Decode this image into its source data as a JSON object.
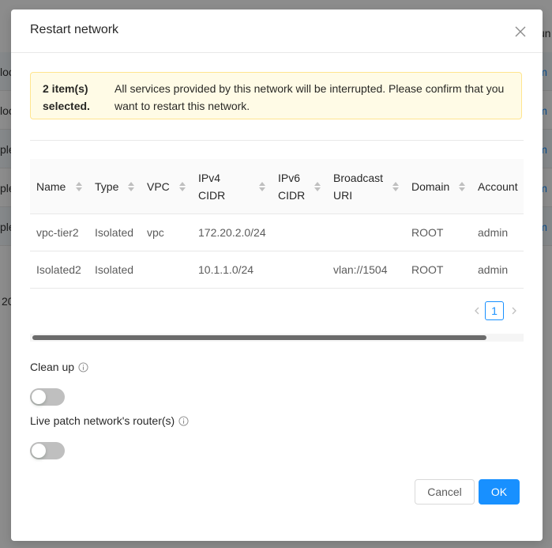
{
  "background": {
    "rows": [
      {
        "text": "loc",
        "link": "m"
      },
      {
        "text": "loc",
        "link": "m"
      },
      {
        "text": "ple",
        "link": "m"
      },
      {
        "text": "ple",
        "link": "m"
      },
      {
        "text": "ple",
        "link": "m"
      }
    ],
    "footer_text": "20",
    "header_text": "un"
  },
  "modal": {
    "title": "Restart network",
    "alert": {
      "count": "2 item(s) selected.",
      "message": "All services provided by this network will be interrupted. Please confirm that you want to restart this network."
    },
    "table": {
      "columns": [
        "Name",
        "Type",
        "VPC",
        "IPv4 CIDR",
        "IPv6 CIDR",
        "Broadcast URI",
        "Domain",
        "Account"
      ],
      "rows": [
        {
          "name": "vpc-tier2",
          "type": "Isolated",
          "vpc": "vpc",
          "ipv4": "172.20.2.0/24",
          "ipv6": "",
          "broadcast": "",
          "domain": "ROOT",
          "account": "admin"
        },
        {
          "name": "Isolated2",
          "type": "Isolated",
          "vpc": "",
          "ipv4": "10.1.1.0/24",
          "ipv6": "",
          "broadcast": "vlan://1504",
          "domain": "ROOT",
          "account": "admin"
        }
      ]
    },
    "pagination": {
      "current_page": "1"
    },
    "fields": {
      "cleanup_label": "Clean up",
      "livepatch_label": "Live patch network's router(s)"
    },
    "buttons": {
      "cancel": "Cancel",
      "ok": "OK"
    }
  },
  "colors": {
    "primary": "#1890ff",
    "alert_bg": "#fffbe6",
    "alert_border": "#ffe58f"
  }
}
